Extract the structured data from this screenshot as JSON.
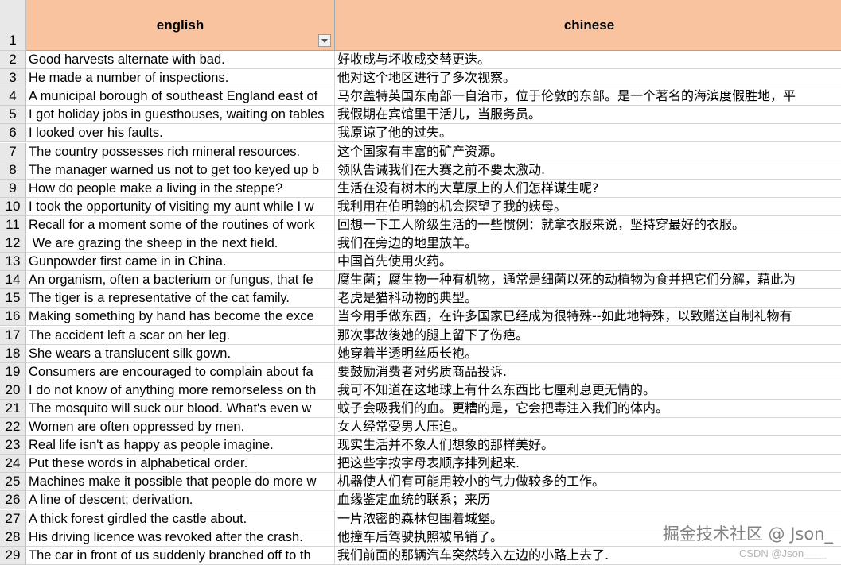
{
  "header": {
    "row_number": "1",
    "col_a": "english",
    "col_b": "chinese"
  },
  "rows": [
    {
      "n": "2",
      "en": "Good harvests alternate with bad.",
      "zh": "好收成与坏收成交替更迭。"
    },
    {
      "n": "3",
      "en": "He made a number of inspections.",
      "zh": "他对这个地区进行了多次视察。"
    },
    {
      "n": "4",
      "en": "A municipal borough of southeast England east of",
      "zh": "马尔盖特英国东南部一自治市，位于伦敦的东部。是一个著名的海滨度假胜地，平"
    },
    {
      "n": "5",
      "en": "I got holiday jobs in guesthouses, waiting on tables",
      "zh": "我假期在宾馆里干活儿，当服务员。"
    },
    {
      "n": "6",
      "en": "I looked over his faults.",
      "zh": "我原谅了他的过失。"
    },
    {
      "n": "7",
      "en": "The country possesses rich mineral resources.",
      "zh": "这个国家有丰富的矿产资源。"
    },
    {
      "n": "8",
      "en": "The manager warned us not to get too keyed up b",
      "zh": "领队告诫我们在大赛之前不要太激动."
    },
    {
      "n": "9",
      "en": "How do people make a living in the steppe?",
      "zh": "生活在没有树木的大草原上的人们怎样谋生呢?"
    },
    {
      "n": "10",
      "en": "I took the opportunity of visiting my aunt while I w",
      "zh": "我利用在伯明翰的机会探望了我的姨母。"
    },
    {
      "n": "11",
      "en": "Recall for a moment some of the routines of work",
      "zh": "回想一下工人阶级生活的一些惯例：就拿衣服来说，坚持穿最好的衣服。"
    },
    {
      "n": "12",
      "en": " We are grazing the sheep in the next field.",
      "zh": "我们在旁边的地里放羊。"
    },
    {
      "n": "13",
      "en": "Gunpowder first came in in China.",
      "zh": "中国首先使用火药。"
    },
    {
      "n": "14",
      "en": "An organism, often a bacterium or fungus, that fe",
      "zh": "腐生菌；腐生物一种有机物，通常是细菌以死的动植物为食并把它们分解，藉此为"
    },
    {
      "n": "15",
      "en": "The tiger is a representative of the cat family.",
      "zh": "老虎是猫科动物的典型。"
    },
    {
      "n": "16",
      "en": "Making something by hand has become the exce",
      "zh": "当今用手做东西，在许多国家已经成为很特殊--如此地特殊，以致赠送自制礼物有"
    },
    {
      "n": "17",
      "en": "The accident left a scar on her leg.",
      "zh": "那次事故後她的腿上留下了伤疤。"
    },
    {
      "n": "18",
      "en": "She wears a translucent silk gown.",
      "zh": "她穿着半透明丝质长袍。"
    },
    {
      "n": "19",
      "en": "Consumers are encouraged to complain about fa",
      "zh": "要鼓励消费者对劣质商品投诉."
    },
    {
      "n": "20",
      "en": "I do not know of anything more remorseless on th",
      "zh": "我可不知道在这地球上有什么东西比七厘利息更无情的。"
    },
    {
      "n": "21",
      "en": "The mosquito will suck our blood. What's even w",
      "zh": "蚊子会吸我们的血。更糟的是，它会把毒注入我们的体内。"
    },
    {
      "n": "22",
      "en": "Women are often oppressed by men.",
      "zh": "女人经常受男人压迫。"
    },
    {
      "n": "23",
      "en": "Real life isn't as happy as people imagine.",
      "zh": "现实生活并不象人们想象的那样美好。"
    },
    {
      "n": "24",
      "en": "Put these words in alphabetical order.",
      "zh": "把这些字按字母表顺序排列起来."
    },
    {
      "n": "25",
      "en": "Machines make it possible that people do more w",
      "zh": "机器使人们有可能用较小的气力做较多的工作。"
    },
    {
      "n": "26",
      "en": "A line of descent; derivation.",
      "zh": "血缘鉴定血统的联系；来历"
    },
    {
      "n": "27",
      "en": "A thick forest girdled the castle about.",
      "zh": "一片浓密的森林包围着城堡。"
    },
    {
      "n": "28",
      "en": "His driving licence was revoked after the crash.",
      "zh": "他撞车后驾驶执照被吊销了。"
    },
    {
      "n": "29",
      "en": "The car in front of us suddenly branched off to th",
      "zh": "我们前面的那辆汽车突然转入左边的小路上去了."
    }
  ],
  "watermark": {
    "main": "掘金技术社区 @ Json_",
    "sub": "CSDN @Json____"
  },
  "colors": {
    "header_fill": "#f9c3a0",
    "row_header_fill": "#e8e8e8",
    "grid_line": "#d6d6d6"
  }
}
